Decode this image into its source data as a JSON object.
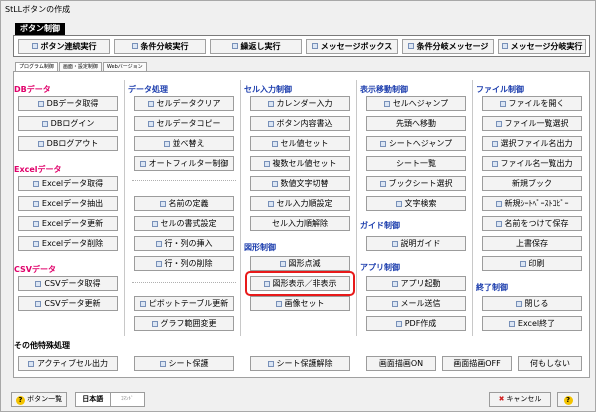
{
  "window": {
    "title": "StLLボタンの作成"
  },
  "button_bar": {
    "title": "ボタン制御",
    "buttons": [
      "ボタン連続実行",
      "条件分岐実行",
      "繰返し実行",
      "メッセージボックス",
      "条件分岐メッセージ",
      "メッセージ分岐実行"
    ]
  },
  "tabs": [
    "プログラム制御",
    "画面・設定制御",
    "Webバージョン"
  ],
  "sections": {
    "db": {
      "title": "DBデータ",
      "buttons": [
        "DBデータ取得",
        "DBログイン",
        "DBログアウト"
      ]
    },
    "excel": {
      "title": "Excelデータ",
      "buttons": [
        "Excelデータ取得",
        "Excelデータ抽出",
        "Excelデータ更新",
        "Excelデータ削除"
      ]
    },
    "csv": {
      "title": "CSVデータ",
      "buttons": [
        "CSVデータ取得",
        "CSVデータ更新"
      ]
    },
    "data": {
      "title": "データ処理",
      "buttons": [
        "セルデータクリア",
        "セルデータコピー",
        "並べ替え",
        "オートフィルター制御",
        "名前の定義",
        "セルの書式設定",
        "行・列の挿入",
        "行・列の削除",
        "ピボットテーブル更新",
        "グラフ範囲変更"
      ]
    },
    "cell": {
      "title": "セル入力制御",
      "buttons": [
        "カレンダー入力",
        "ボタン内容書込",
        "セル値セット",
        "複数セル値セット",
        "数値文字切替",
        "セル入力順設定",
        "セル入力順解除"
      ]
    },
    "shape": {
      "title": "図形制御",
      "buttons": [
        "図形点滅",
        "図形表示／非表示",
        "画像セット"
      ]
    },
    "move": {
      "title": "表示移動制御",
      "buttons": [
        "セルへジャンプ",
        "先頭へ移動",
        "シートへジャンプ",
        "シート一覧",
        "ブックシート選択",
        "文字検索"
      ]
    },
    "guide": {
      "title": "ガイド制御",
      "buttons": [
        "説明ガイド"
      ]
    },
    "app": {
      "title": "アプリ制御",
      "buttons": [
        "アプリ起動",
        "メール送信",
        "PDF作成"
      ]
    },
    "file": {
      "title": "ファイル制御",
      "buttons": [
        "ファイルを開く",
        "ファイル一覧選択",
        "選択ファイル名出力",
        "ファイル名一覧出力",
        "新規ブック",
        "新規ｼｰﾄﾍﾟｰｽﾄｺﾋﾟｰ",
        "名前をつけて保存",
        "上書保存",
        "印刷"
      ]
    },
    "end": {
      "title": "終了制御",
      "buttons": [
        "閉じる",
        "Excel終了"
      ]
    },
    "other": {
      "title": "その他特殊処理",
      "buttons": [
        "アクティブセル出力",
        "シート保護",
        "シート保護解除",
        "画面描画ON",
        "画面描画OFF",
        "何もしない"
      ]
    }
  },
  "bottom": {
    "list": "ボタン一覧",
    "lang_on": "日本語",
    "lang_off": "ｺﾏﾝﾄﾞ",
    "cancel": "キャンセル",
    "help": "?"
  }
}
